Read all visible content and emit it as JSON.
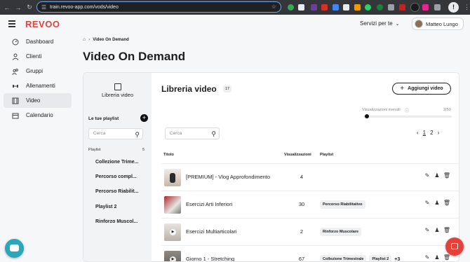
{
  "browser": {
    "url": "train.revoo-app.com/vods/video",
    "update_badge": "!"
  },
  "header": {
    "logo": "REVOO",
    "services": "Servizi per te",
    "user_name": "Matteo Lungo"
  },
  "sidebar": {
    "items": [
      {
        "label": "Dashboard",
        "icon": "gauge-icon"
      },
      {
        "label": "Clienti",
        "icon": "person-icon"
      },
      {
        "label": "Gruppi",
        "icon": "group-icon"
      },
      {
        "label": "Allenamenti",
        "icon": "dumbbell-icon"
      },
      {
        "label": "Video",
        "icon": "film-icon"
      },
      {
        "label": "Calendario",
        "icon": "calendar-icon"
      }
    ],
    "active": "Video"
  },
  "page": {
    "breadcrumb": "Video On Demand",
    "title": "Video On Demand"
  },
  "library_panel": {
    "tab_label": "Libreria video",
    "playlists_heading": "Le tue playlist",
    "search_placeholder": "Cerca",
    "playlist_label": "Playlist",
    "playlist_count": "5",
    "playlists": [
      "Collezione Trime...",
      "Percorso compl...",
      "Percorso Riabilit...",
      "Playlist 2",
      "Rinforzo Muscol..."
    ]
  },
  "library": {
    "title": "Libreria video",
    "count": "17",
    "add_button": "Aggiungi video",
    "views_label": "Visualizzazioni mensili",
    "views_value": "2/50",
    "views_fraction": 0.04,
    "search_placeholder": "Cerca",
    "pages": [
      "1",
      "2"
    ],
    "current_page": "1",
    "columns": {
      "title": "Titolo",
      "views": "Visualizzazioni",
      "playlist": "Playlist"
    },
    "rows": [
      {
        "title": "[PREMIUM] - Vlog Approfondimento",
        "views": "4",
        "tags": [],
        "more": ""
      },
      {
        "title": "Esercizi Arti Inferiori",
        "views": "30",
        "tags": [
          "Percorso Riabilitativo"
        ],
        "more": ""
      },
      {
        "title": "Esercizi Multiarticolari",
        "views": "2",
        "tags": [
          "Rinforzo Muscolare"
        ],
        "more": ""
      },
      {
        "title": "Giorno 1 - Stretching",
        "views": "67",
        "tags": [
          "Collezione Trimestrale",
          "Playlist 2"
        ],
        "more": "+3"
      }
    ]
  },
  "colors": {
    "brand": "#e5413b",
    "chat_fab": "#2aa7b8"
  }
}
